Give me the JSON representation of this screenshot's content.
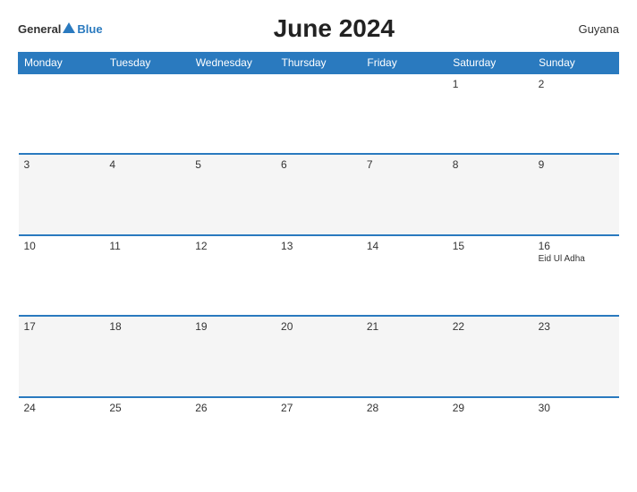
{
  "header": {
    "logo_general": "General",
    "logo_blue": "Blue",
    "title": "June 2024",
    "country": "Guyana"
  },
  "weekdays": [
    "Monday",
    "Tuesday",
    "Wednesday",
    "Thursday",
    "Friday",
    "Saturday",
    "Sunday"
  ],
  "weeks": [
    [
      {
        "day": "",
        "holiday": ""
      },
      {
        "day": "",
        "holiday": ""
      },
      {
        "day": "",
        "holiday": ""
      },
      {
        "day": "",
        "holiday": ""
      },
      {
        "day": "",
        "holiday": ""
      },
      {
        "day": "1",
        "holiday": ""
      },
      {
        "day": "2",
        "holiday": ""
      }
    ],
    [
      {
        "day": "3",
        "holiday": ""
      },
      {
        "day": "4",
        "holiday": ""
      },
      {
        "day": "5",
        "holiday": ""
      },
      {
        "day": "6",
        "holiday": ""
      },
      {
        "day": "7",
        "holiday": ""
      },
      {
        "day": "8",
        "holiday": ""
      },
      {
        "day": "9",
        "holiday": ""
      }
    ],
    [
      {
        "day": "10",
        "holiday": ""
      },
      {
        "day": "11",
        "holiday": ""
      },
      {
        "day": "12",
        "holiday": ""
      },
      {
        "day": "13",
        "holiday": ""
      },
      {
        "day": "14",
        "holiday": ""
      },
      {
        "day": "15",
        "holiday": ""
      },
      {
        "day": "16",
        "holiday": "Eid Ul Adha"
      }
    ],
    [
      {
        "day": "17",
        "holiday": ""
      },
      {
        "day": "18",
        "holiday": ""
      },
      {
        "day": "19",
        "holiday": ""
      },
      {
        "day": "20",
        "holiday": ""
      },
      {
        "day": "21",
        "holiday": ""
      },
      {
        "day": "22",
        "holiday": ""
      },
      {
        "day": "23",
        "holiday": ""
      }
    ],
    [
      {
        "day": "24",
        "holiday": ""
      },
      {
        "day": "25",
        "holiday": ""
      },
      {
        "day": "26",
        "holiday": ""
      },
      {
        "day": "27",
        "holiday": ""
      },
      {
        "day": "28",
        "holiday": ""
      },
      {
        "day": "29",
        "holiday": ""
      },
      {
        "day": "30",
        "holiday": ""
      }
    ]
  ]
}
